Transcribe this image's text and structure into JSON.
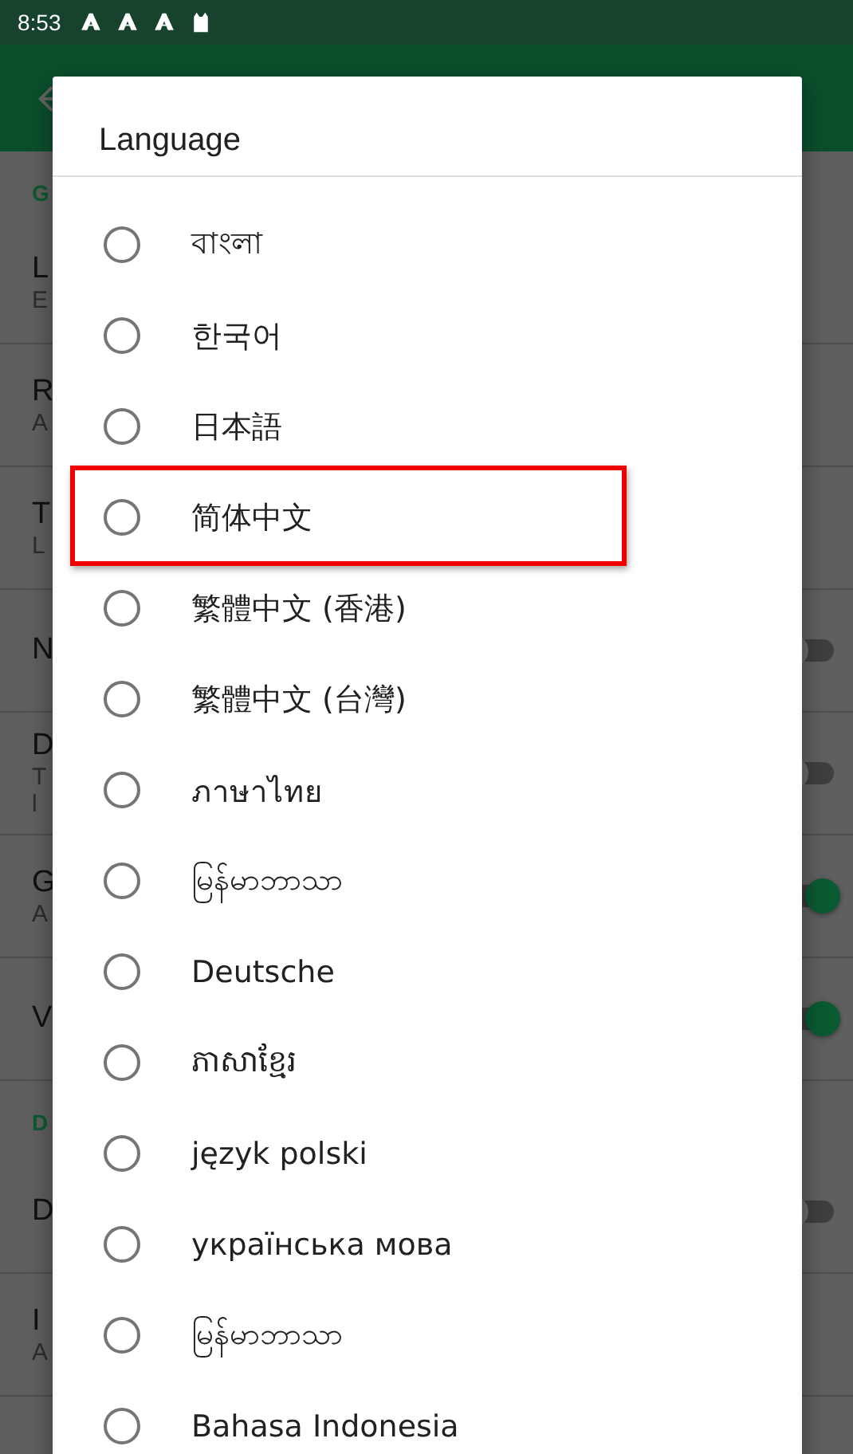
{
  "status_bar": {
    "time": "8:53"
  },
  "background": {
    "sections": [
      {
        "header": "G",
        "rows": [
          {
            "title": "L",
            "subtitle": [
              "E"
            ]
          },
          {
            "title": "R",
            "subtitle": [
              "A"
            ]
          },
          {
            "title": "T",
            "subtitle": [
              "L"
            ]
          },
          {
            "title": "N",
            "subtitle": [],
            "toggle": {
              "on": false
            }
          },
          {
            "title": "D",
            "subtitle": [
              "T",
              "l"
            ],
            "toggle": {
              "on": false
            }
          },
          {
            "title": "G",
            "subtitle": [
              "A"
            ],
            "toggle": {
              "on": true
            }
          },
          {
            "title": "V",
            "subtitle": [],
            "toggle": {
              "on": true
            }
          }
        ]
      },
      {
        "header": "D",
        "rows": [
          {
            "title": "D",
            "subtitle": [],
            "toggle": {
              "on": false
            }
          },
          {
            "title": "I",
            "subtitle": [
              "A"
            ]
          }
        ]
      }
    ]
  },
  "dialog": {
    "title": "Language",
    "options": [
      {
        "label": "বাংলা",
        "selected": false,
        "highlighted": false
      },
      {
        "label": "한국어",
        "selected": false,
        "highlighted": false
      },
      {
        "label": "日本語",
        "selected": false,
        "highlighted": false
      },
      {
        "label": "简体中文",
        "selected": false,
        "highlighted": true
      },
      {
        "label": "繁體中文 (香港)",
        "selected": false,
        "highlighted": false
      },
      {
        "label": "繁體中文 (台灣)",
        "selected": false,
        "highlighted": false
      },
      {
        "label": "ภาษาไทย",
        "selected": false,
        "highlighted": false
      },
      {
        "label": "မြန်မာဘာသာ",
        "selected": false,
        "highlighted": false
      },
      {
        "label": "Deutsche",
        "selected": false,
        "highlighted": false
      },
      {
        "label": "ភាសាខ្មែរ",
        "selected": false,
        "highlighted": false
      },
      {
        "label": "język polski",
        "selected": false,
        "highlighted": false
      },
      {
        "label": "українська мова",
        "selected": false,
        "highlighted": false
      },
      {
        "label": "မြန်မာဘာသာ",
        "selected": false,
        "highlighted": false
      },
      {
        "label": "Bahasa Indonesia",
        "selected": false,
        "highlighted": false
      }
    ]
  }
}
